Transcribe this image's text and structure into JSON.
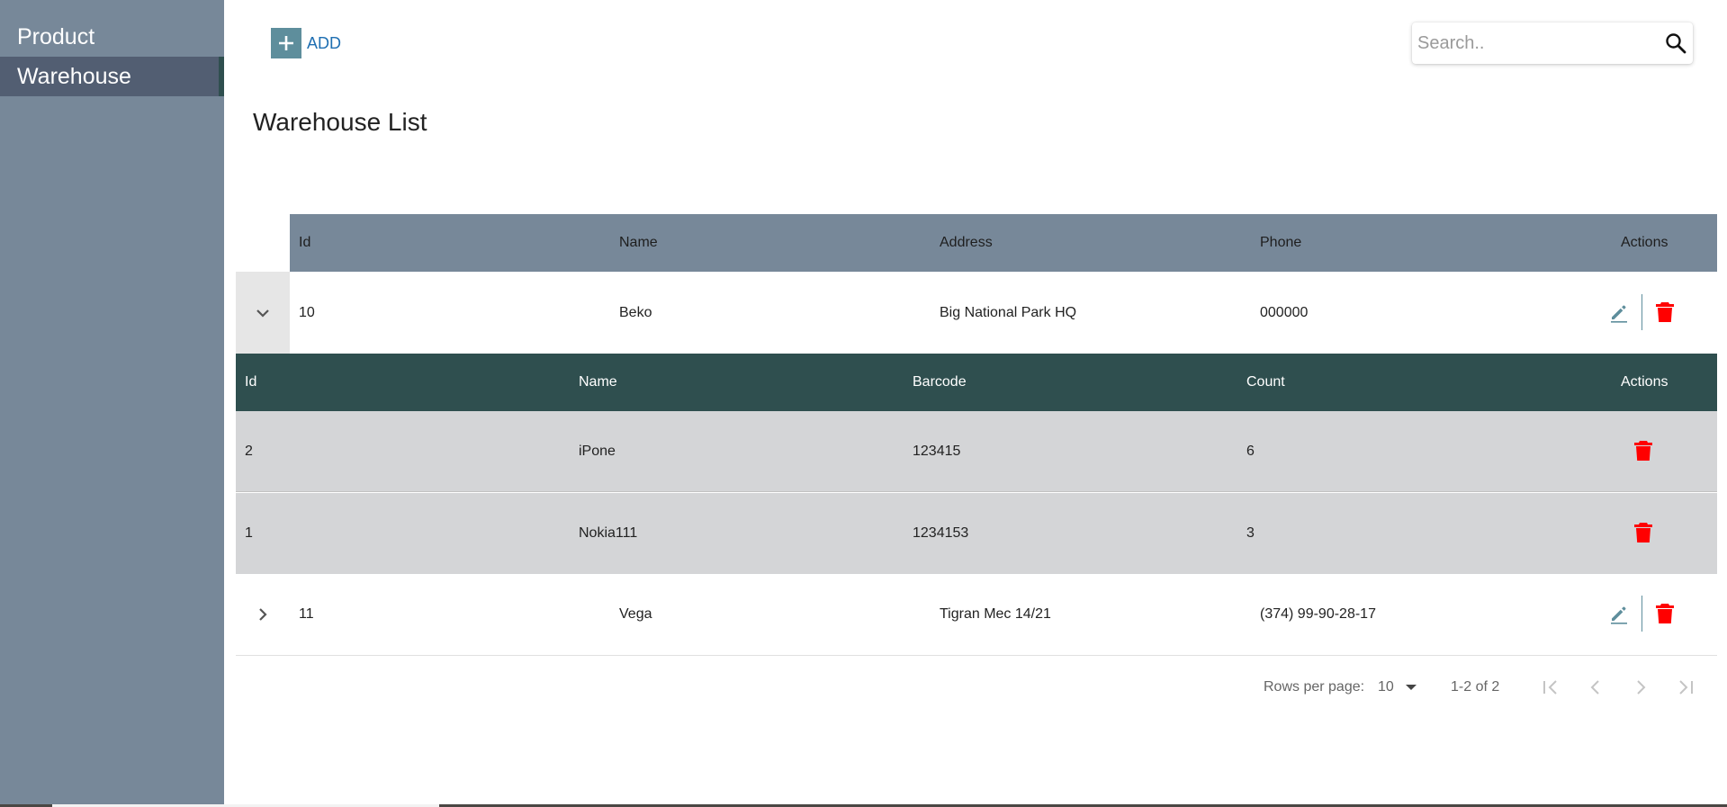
{
  "sidebar": {
    "items": [
      {
        "label": "Product"
      },
      {
        "label": "Warehouse"
      }
    ]
  },
  "toolbar": {
    "add_label": "ADD",
    "add_icon": "plus-icon"
  },
  "search": {
    "placeholder": "Search..",
    "value": "",
    "icon": "search-icon"
  },
  "page": {
    "title": "Warehouse List"
  },
  "warehouse_table": {
    "columns": [
      "Id",
      "Name",
      "Address",
      "Phone",
      "Actions"
    ],
    "rows": [
      {
        "id": "10",
        "name": "Beko",
        "address": "Big National Park HQ",
        "phone": "000000",
        "expanded": true
      },
      {
        "id": "11",
        "name": "Vega",
        "address": "Tigran Mec 14/21",
        "phone": "(374) 99-90-28-17",
        "expanded": false
      }
    ]
  },
  "product_table": {
    "columns": [
      "Id",
      "Name",
      "Barcode",
      "Count",
      "Actions"
    ],
    "rows": [
      {
        "id": "2",
        "name": "iPone",
        "barcode": "123415",
        "count": "6"
      },
      {
        "id": "1",
        "name": "Nokia111",
        "barcode": "1234153",
        "count": "3"
      }
    ]
  },
  "pagination": {
    "rows_per_page_label": "Rows per page:",
    "rows_per_page_value": "10",
    "range_text": "1-2 of 2"
  },
  "colors": {
    "sidebar_bg": "#778899",
    "sidebar_active": "#525e72",
    "subheader_bg": "#2f4f4f",
    "accent": "#5e8e9c",
    "delete": "#ff0000",
    "link": "#1f6fb2"
  }
}
